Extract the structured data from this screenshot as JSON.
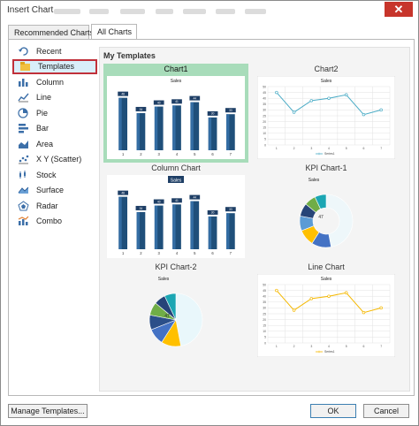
{
  "dialog": {
    "title": "Insert Chart",
    "close_glyph": "✕"
  },
  "tabs": [
    {
      "label": "Recommended Charts"
    },
    {
      "label": "All Charts"
    }
  ],
  "sidebar": {
    "items": [
      {
        "label": "Recent",
        "icon": "recent-icon"
      },
      {
        "label": "Templates",
        "icon": "templates-icon"
      },
      {
        "label": "Column",
        "icon": "column-chart-icon"
      },
      {
        "label": "Line",
        "icon": "line-chart-icon"
      },
      {
        "label": "Pie",
        "icon": "pie-chart-icon"
      },
      {
        "label": "Bar",
        "icon": "bar-chart-icon"
      },
      {
        "label": "Area",
        "icon": "area-chart-icon"
      },
      {
        "label": "X Y (Scatter)",
        "icon": "scatter-chart-icon"
      },
      {
        "label": "Stock",
        "icon": "stock-chart-icon"
      },
      {
        "label": "Surface",
        "icon": "surface-chart-icon"
      },
      {
        "label": "Radar",
        "icon": "radar-chart-icon"
      },
      {
        "label": "Combo",
        "icon": "combo-chart-icon"
      }
    ]
  },
  "content": {
    "header": "My Templates",
    "templates": [
      {
        "name": "Chart1"
      },
      {
        "name": "Chart2"
      },
      {
        "name": "Column Chart"
      },
      {
        "name": "KPI Chart-1"
      },
      {
        "name": "KPI Chart-2"
      },
      {
        "name": "Line Chart"
      }
    ]
  },
  "footer": {
    "manage_label": "Manage Templates...",
    "ok_label": "OK",
    "cancel_label": "Cancel"
  },
  "colors": {
    "selected_template": "#a8dcba",
    "selected_sidebar_border": "#c0303a",
    "close_button": "#c7352b",
    "bar": "#1f4f7a",
    "line": "#4bacc6",
    "line_alt": "#f5b800"
  },
  "chart_data": [
    {
      "type": "bar",
      "title": "Sales",
      "categories": [
        "1",
        "2",
        "3",
        "4",
        "5",
        "6",
        "7"
      ],
      "values": [
        48,
        34,
        40,
        41,
        44,
        30,
        33
      ]
    },
    {
      "type": "line",
      "title": "Sales",
      "categories": [
        "1",
        "2",
        "3",
        "4",
        "5",
        "6",
        "7"
      ],
      "series": [
        {
          "name": "Series1",
          "values": [
            45,
            28,
            38,
            40,
            43,
            26,
            30
          ]
        }
      ],
      "ylim": [
        0,
        50
      ],
      "yticks": [
        "0",
        "5",
        "10",
        "15",
        "20",
        "25",
        "30",
        "35",
        "40",
        "45",
        "50"
      ]
    },
    {
      "type": "bar",
      "title": "Sales",
      "categories": [
        "1",
        "2",
        "3",
        "4",
        "5",
        "6",
        "7"
      ],
      "values": [
        48,
        34,
        40,
        41,
        44,
        30,
        33
      ]
    },
    {
      "type": "pie",
      "title": "Sales",
      "center_label": "47",
      "values": [
        47,
        12,
        10,
        9,
        8,
        7,
        7
      ]
    },
    {
      "type": "pie",
      "title": "Sales",
      "center_label": "47",
      "values": [
        47,
        12,
        10,
        9,
        8,
        7,
        7
      ]
    },
    {
      "type": "line",
      "title": "Sales",
      "categories": [
        "1",
        "2",
        "3",
        "4",
        "5",
        "6",
        "7"
      ],
      "series": [
        {
          "name": "Series1",
          "values": [
            45,
            28,
            38,
            40,
            43,
            26,
            30
          ]
        }
      ],
      "ylim": [
        0,
        50
      ],
      "yticks": [
        "0",
        "5",
        "10",
        "15",
        "20",
        "25",
        "30",
        "35",
        "40",
        "45",
        "50"
      ]
    }
  ]
}
